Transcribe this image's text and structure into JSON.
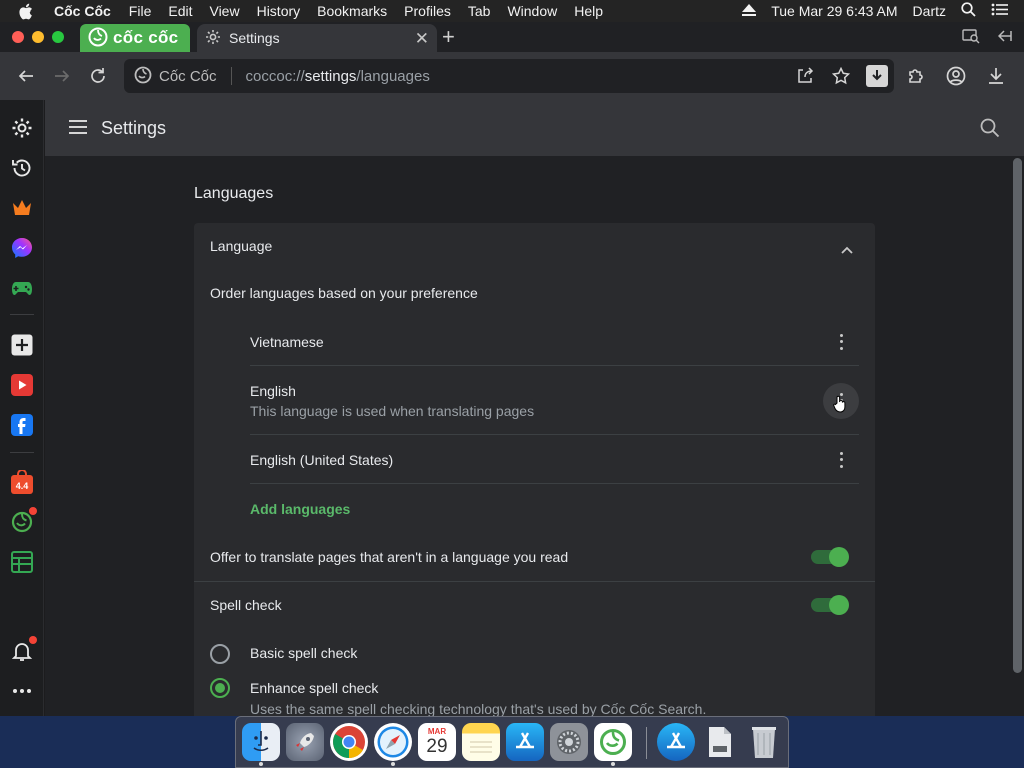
{
  "menubar": {
    "app_name": "Cốc Cốc",
    "items": [
      "File",
      "Edit",
      "View",
      "History",
      "Bookmarks",
      "Profiles",
      "Tab",
      "Window",
      "Help"
    ],
    "clock": "Tue Mar 29  6:43 AM",
    "user": "Dartz",
    "icons": [
      "apple-icon",
      "eject-icon",
      "search-icon",
      "control-center-icon"
    ]
  },
  "tabs": {
    "brand_label": "cốc cốc",
    "active_title": "Settings",
    "close_glyph": "✕",
    "new_tab_glyph": "+"
  },
  "toolbar": {
    "site_name": "Cốc Cốc",
    "url_prefix": "coccoc://",
    "url_host": "settings",
    "url_path": "/languages"
  },
  "sidebar": {
    "items": [
      "settings-icon",
      "history-icon",
      "crown-icon",
      "messenger-icon",
      "gamepad-icon",
      "add-icon",
      "youtube-icon",
      "facebook-icon",
      "shopee-icon",
      "coccoc-icon",
      "notes-icon",
      "bell-icon",
      "more-icon"
    ]
  },
  "settings": {
    "header_title": "Settings",
    "section_title": "Languages",
    "language_heading": "Language",
    "order_label": "Order languages based on your preference",
    "languages": [
      {
        "name": "Vietnamese",
        "note": ""
      },
      {
        "name": "English",
        "note": "This language is used when translating pages"
      },
      {
        "name": "English (United States)",
        "note": ""
      }
    ],
    "add_languages": "Add languages",
    "offer_translate": "Offer to translate pages that aren't in a language you read",
    "offer_translate_on": true,
    "spell_check": "Spell check",
    "spell_check_on": true,
    "basic_spell": "Basic spell check",
    "enhanced_spell": "Enhance spell check",
    "enhanced_desc": "Uses the same spell checking technology that's used by Cốc Cốc Search."
  },
  "colors": {
    "accent": "#4caf50",
    "background": "#202124",
    "card": "#2a2b2e"
  },
  "dock": {
    "calendar_month": "MAR",
    "calendar_day": "29",
    "apps": [
      "finder-icon",
      "launchpad-icon",
      "chrome-icon",
      "safari-icon",
      "calendar-icon",
      "notes-icon",
      "app-store-icon",
      "system-preferences-icon",
      "coccoc-browser-icon",
      "app-store-download-icon",
      "document-icon",
      "trash-icon"
    ]
  }
}
